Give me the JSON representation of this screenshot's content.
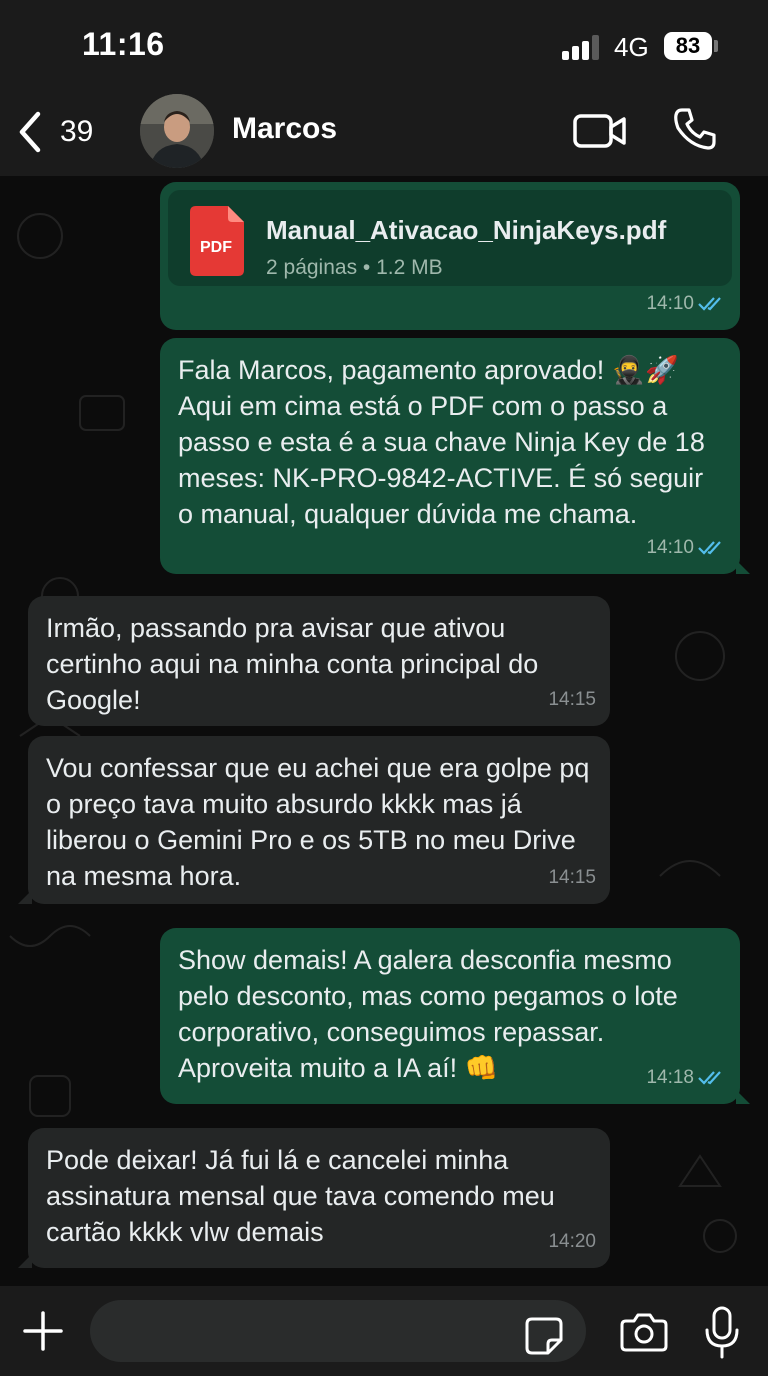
{
  "status_bar": {
    "time": "11:16",
    "network": "4G",
    "battery": "83"
  },
  "header": {
    "back_count": "39",
    "contact_name": "Marcos"
  },
  "messages": [
    {
      "type": "file",
      "direction": "out",
      "file_name": "Manual_Ativacao_NinjaKeys.pdf",
      "file_meta": "2 páginas • 1.2 MB",
      "file_icon_label": "PDF",
      "time": "14:10"
    },
    {
      "type": "text",
      "direction": "out",
      "text": "Fala Marcos, pagamento aprovado! 🥷🚀 Aqui em cima está o PDF com o passo a passo e esta é a sua chave Ninja Key de 18 meses: NK-PRO-9842-ACTIVE. É só seguir o manual, qualquer dúvida me chama.",
      "time": "14:10"
    },
    {
      "type": "text",
      "direction": "in",
      "text": "Irmão, passando pra avisar que ativou certinho aqui na minha conta principal do Google!",
      "time": "14:15"
    },
    {
      "type": "text",
      "direction": "in",
      "text": "Vou confessar que eu achei que era golpe pq o preço tava muito absurdo kkkk mas já liberou o Gemini Pro e os 5TB no meu Drive na mesma hora.",
      "time": "14:15"
    },
    {
      "type": "text",
      "direction": "out",
      "text": "Show demais! A galera desconfia mesmo pelo desconto, mas como pegamos o lote corporativo, conseguimos repassar. Aproveita muito a IA aí! 👊",
      "time": "14:18"
    },
    {
      "type": "text",
      "direction": "in",
      "text": "Pode deixar! Já fui lá e cancelei minha assinatura mensal que tava comendo meu cartão kkkk vlw demais",
      "time": "14:20"
    }
  ],
  "colors": {
    "outgoing_bubble": "#144d37",
    "incoming_bubble": "#242626",
    "read_ticks": "#53bdeb",
    "pdf_red": "#e53935"
  },
  "icons": [
    "chevron-left-icon",
    "video-call-icon",
    "phone-icon",
    "pdf-icon",
    "double-check-icon",
    "plus-icon",
    "sticker-icon",
    "camera-icon",
    "microphone-icon"
  ]
}
